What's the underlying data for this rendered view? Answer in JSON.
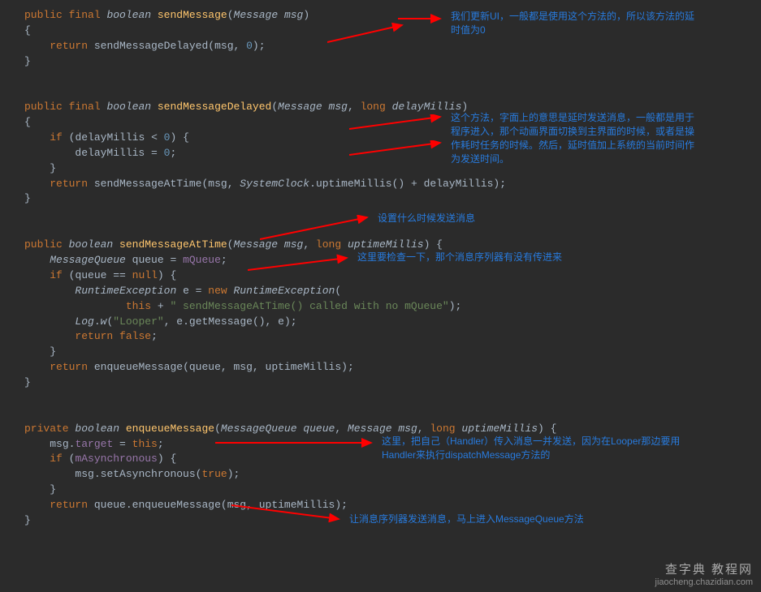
{
  "code": {
    "public": "public",
    "private": "private",
    "final": "final",
    "boolean": "boolean",
    "return": "return",
    "if": "if",
    "long": "long",
    "null": "null",
    "new": "new",
    "false": "false",
    "true": "true",
    "this": "this",
    "sendMessage": "sendMessage",
    "sendMessageDelayed": "sendMessageDelayed",
    "sendMessageAtTime": "sendMessageAtTime",
    "enqueueMessage": "enqueueMessage",
    "Message": "Message",
    "MessageQueue": "MessageQueue",
    "msg": "msg",
    "delayMillis": "delayMillis",
    "uptimeMillis": "uptimeMillis",
    "queue": "queue",
    "mQueue": "mQueue",
    "RuntimeException": "RuntimeException",
    "e": "e",
    "SystemClock": "SystemClock",
    "uptimeMillisCall": "uptimeMillis",
    "Log": "Log",
    "w": "w",
    "getMessage": "getMessage",
    "target": "target",
    "mAsynchronous": "mAsynchronous",
    "setAsynchronous": "setAsynchronous",
    "zero": "0",
    "strCalled": "\" sendMessageAtTime() called with no mQueue\"",
    "strLooper": "\"Looper\""
  },
  "anno": {
    "a1l1": "我们更新UI，一般都是使用这个方法的，所以该方法的延",
    "a1l2": "时值为0",
    "a2l1": "这个方法，字面上的意思是延时发送消息，一般都是用于",
    "a2l2": "程序进入，那个动画界面切换到主界面的时候，或者是操",
    "a2l3": "作耗时任务的时候。然后，延时值加上系统的当前时间作",
    "a2l4": "为发送时间。",
    "a3": "设置什么时候发送消息",
    "a4": "这里要检查一下，那个消息序列器有没有传进来",
    "a5l1": "这里，把自己（Handler）传入消息一并发送，因为在Looper那边要用",
    "a5l2": "Handler来执行dispatchMessage方法的",
    "a6": "让消息序列器发送消息，马上进入MessageQueue方法"
  },
  "wm": {
    "t1": "查字典 教程网",
    "t2": "jiaocheng.chazidian.com"
  }
}
